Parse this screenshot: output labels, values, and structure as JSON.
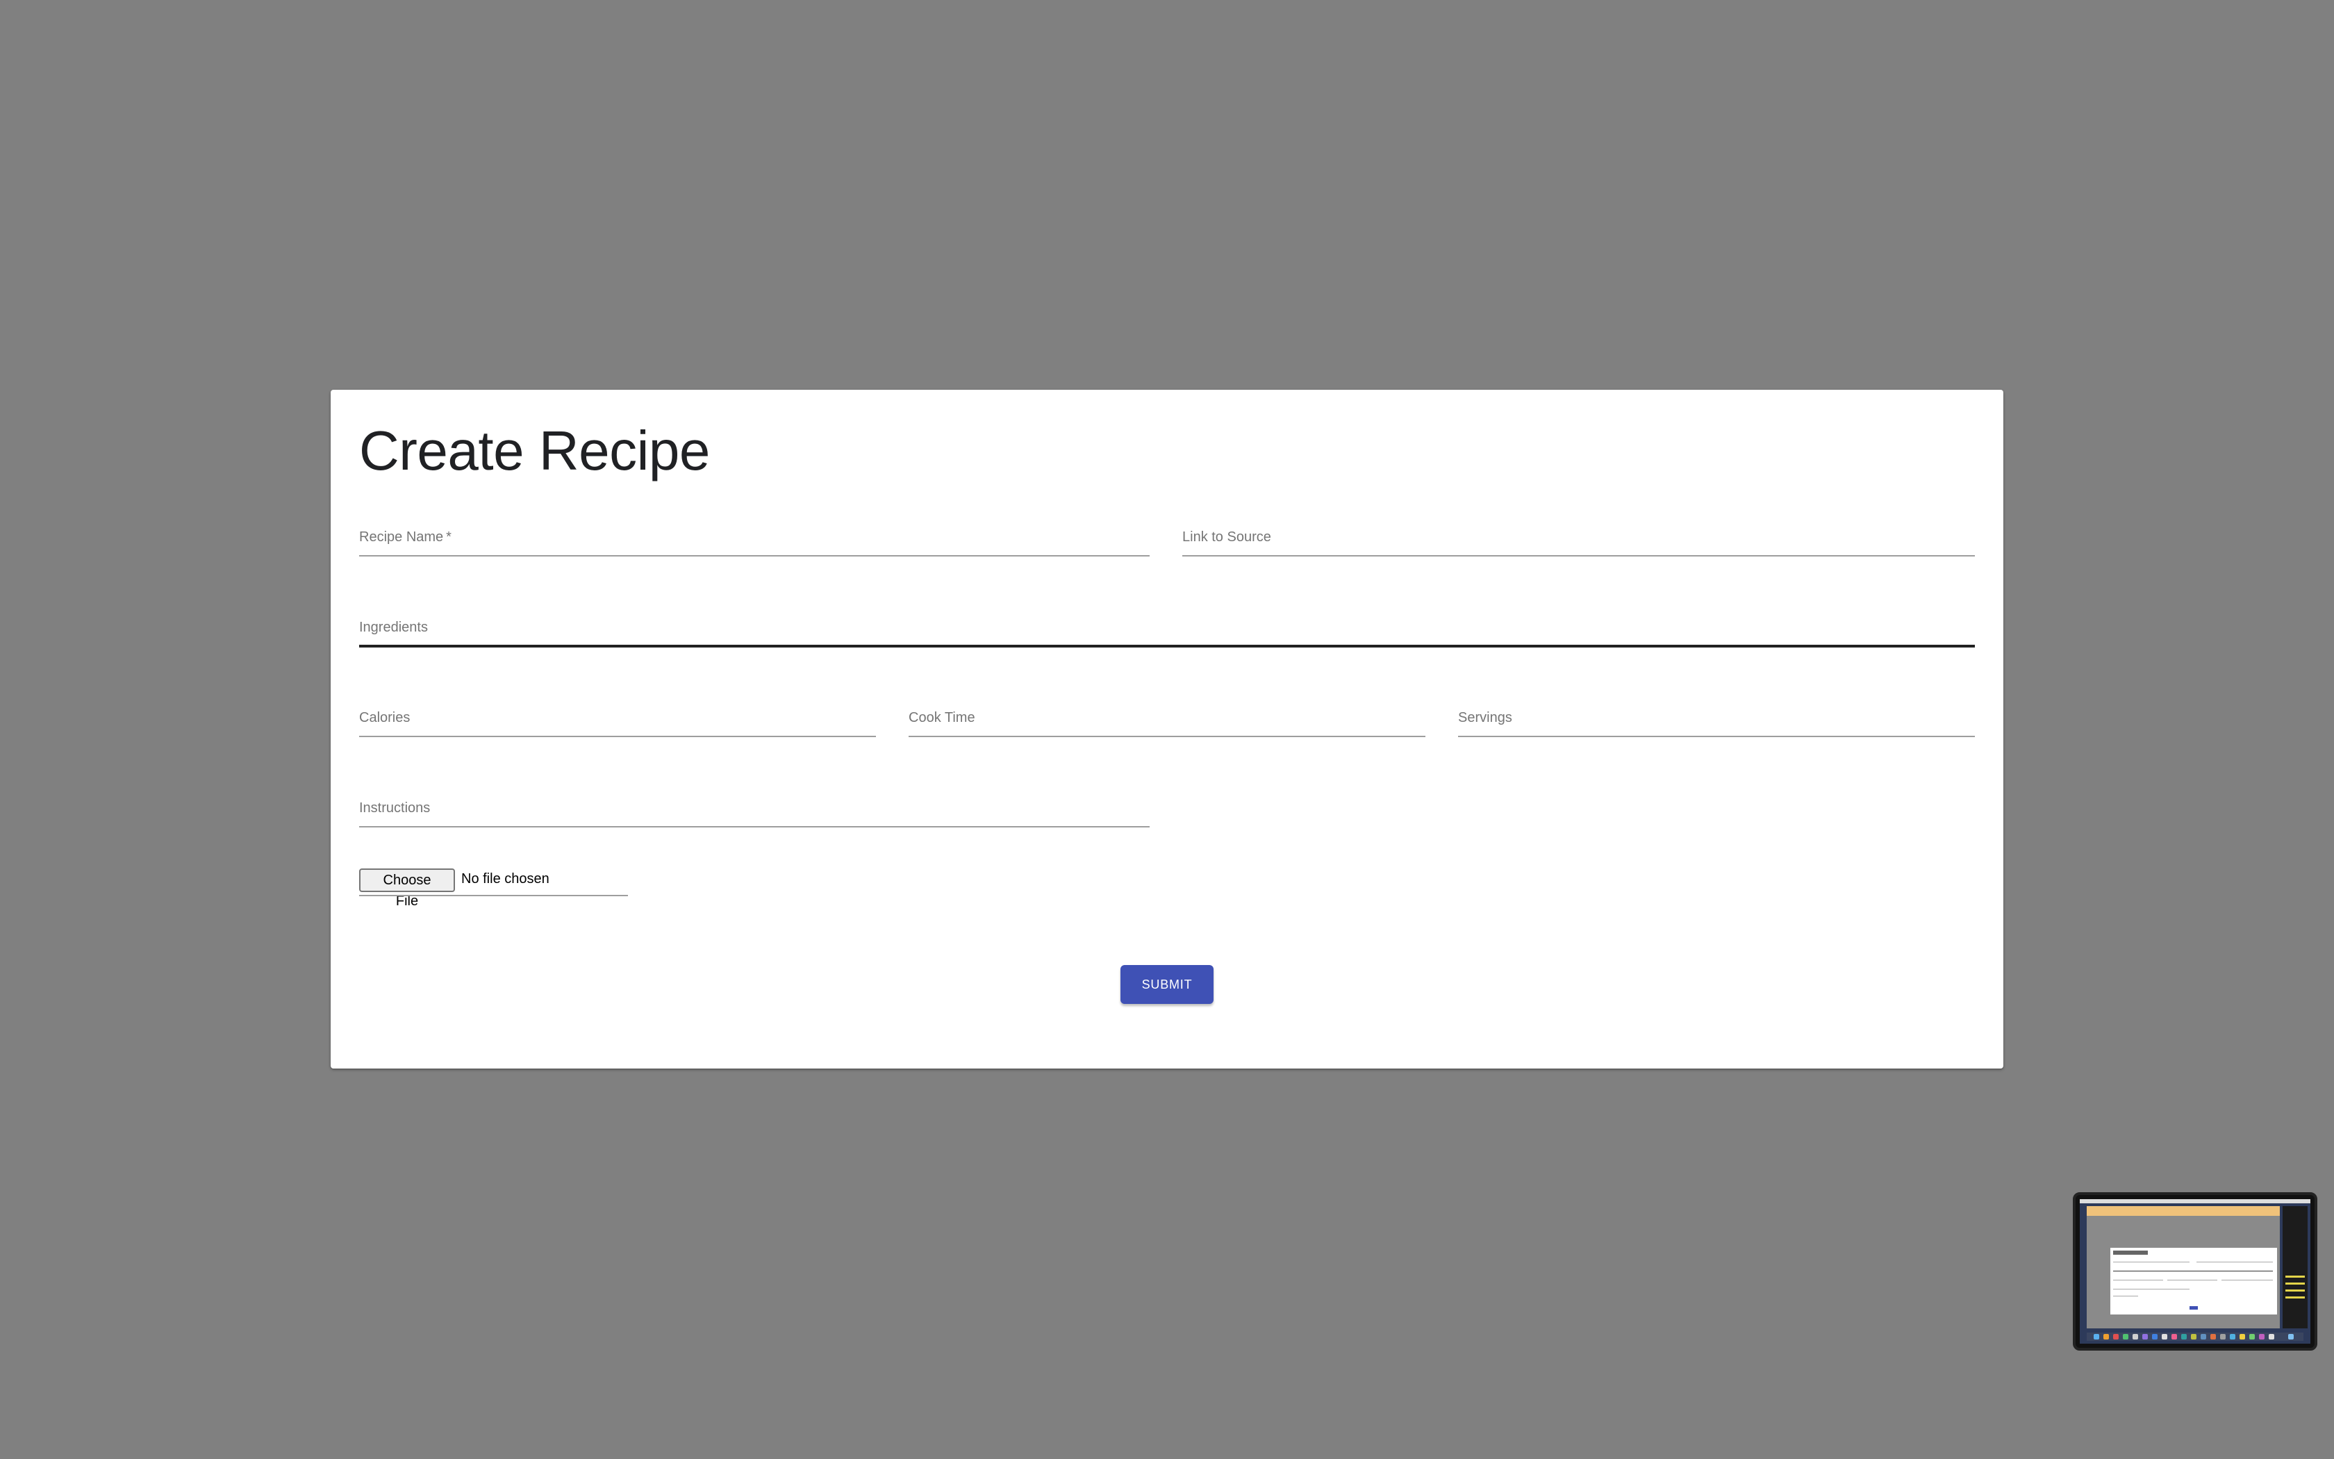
{
  "form": {
    "title": "Create Recipe",
    "fields": {
      "recipe_name": {
        "label": "Recipe Name",
        "required_mark": "*",
        "value": ""
      },
      "link_to_source": {
        "label": "Link to Source",
        "value": ""
      },
      "ingredients": {
        "label": "Ingredients",
        "value": ""
      },
      "calories": {
        "label": "Calories",
        "value": ""
      },
      "cook_time": {
        "label": "Cook Time",
        "value": ""
      },
      "servings": {
        "label": "Servings",
        "value": ""
      },
      "instructions": {
        "label": "Instructions",
        "value": ""
      }
    },
    "file_input": {
      "button_label": "Choose File",
      "status_text": "No file chosen"
    },
    "submit_label": "SUBMIT"
  },
  "colors": {
    "background": "#808080",
    "card": "#ffffff",
    "accent": "#3f51b5",
    "label": "#757575",
    "underline": "#9e9e9e",
    "focused_underline": "#212121"
  }
}
